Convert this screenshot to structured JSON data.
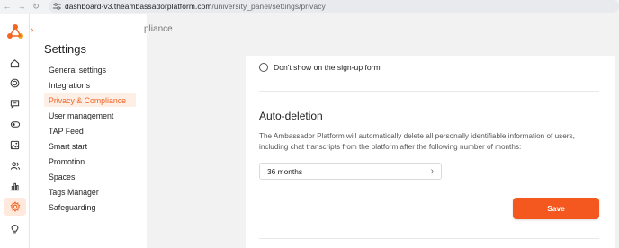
{
  "browser": {
    "url_host": "dashboard-v3.theambassadorplatform.com",
    "url_path": "/university_panel/settings/privacy"
  },
  "page_header": "pliance",
  "settings": {
    "title": "Settings",
    "items": [
      {
        "label": "General settings"
      },
      {
        "label": "Integrations"
      },
      {
        "label": "Privacy & Compliance",
        "active": true
      },
      {
        "label": "User management"
      },
      {
        "label": "TAP Feed"
      },
      {
        "label": "Smart start"
      },
      {
        "label": "Promotion"
      },
      {
        "label": "Spaces"
      },
      {
        "label": "Tags Manager"
      },
      {
        "label": "Safeguarding"
      }
    ]
  },
  "rail_icons": [
    "home-icon",
    "target-icon",
    "chat-icon",
    "toggle-icon",
    "image-icon",
    "users-icon",
    "chart-icon",
    "settings-icon",
    "lightbulb-icon"
  ],
  "card": {
    "radio_label": "Don't show on the sign-up form",
    "section_title": "Auto-deletion",
    "section_desc": "The Ambassador Platform will automatically delete all personally identifiable information of users, including chat transcripts from the platform after the following number of months:",
    "select_value": "36 months",
    "save_label": "Save"
  },
  "colors": {
    "accent": "#f4581e",
    "active_bg": "#fdeee6"
  }
}
